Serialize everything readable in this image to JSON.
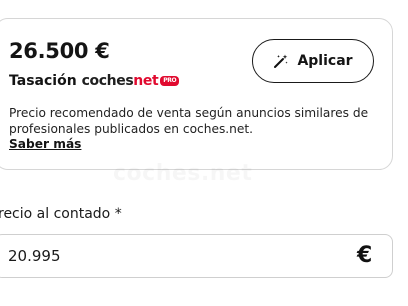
{
  "valuation": {
    "price": "26.500 €",
    "label": "Tasación",
    "brand_main": "coches",
    "brand_accent": "net",
    "brand_badge": "PRO",
    "apply_label": "Aplicar",
    "apply_icon": "magic-wand-icon",
    "description": "Precio recomendado de venta según anuncios similares de profesionales publicados en coches.net.",
    "link_label": "Saber más",
    "watermark": "coches.net"
  },
  "cash_price": {
    "label": "recio al contado *",
    "value": "20.995",
    "currency_symbol": "€"
  },
  "colors": {
    "brand_red": "#e10a2f",
    "text": "#141414",
    "border": "#d6d6d6"
  }
}
